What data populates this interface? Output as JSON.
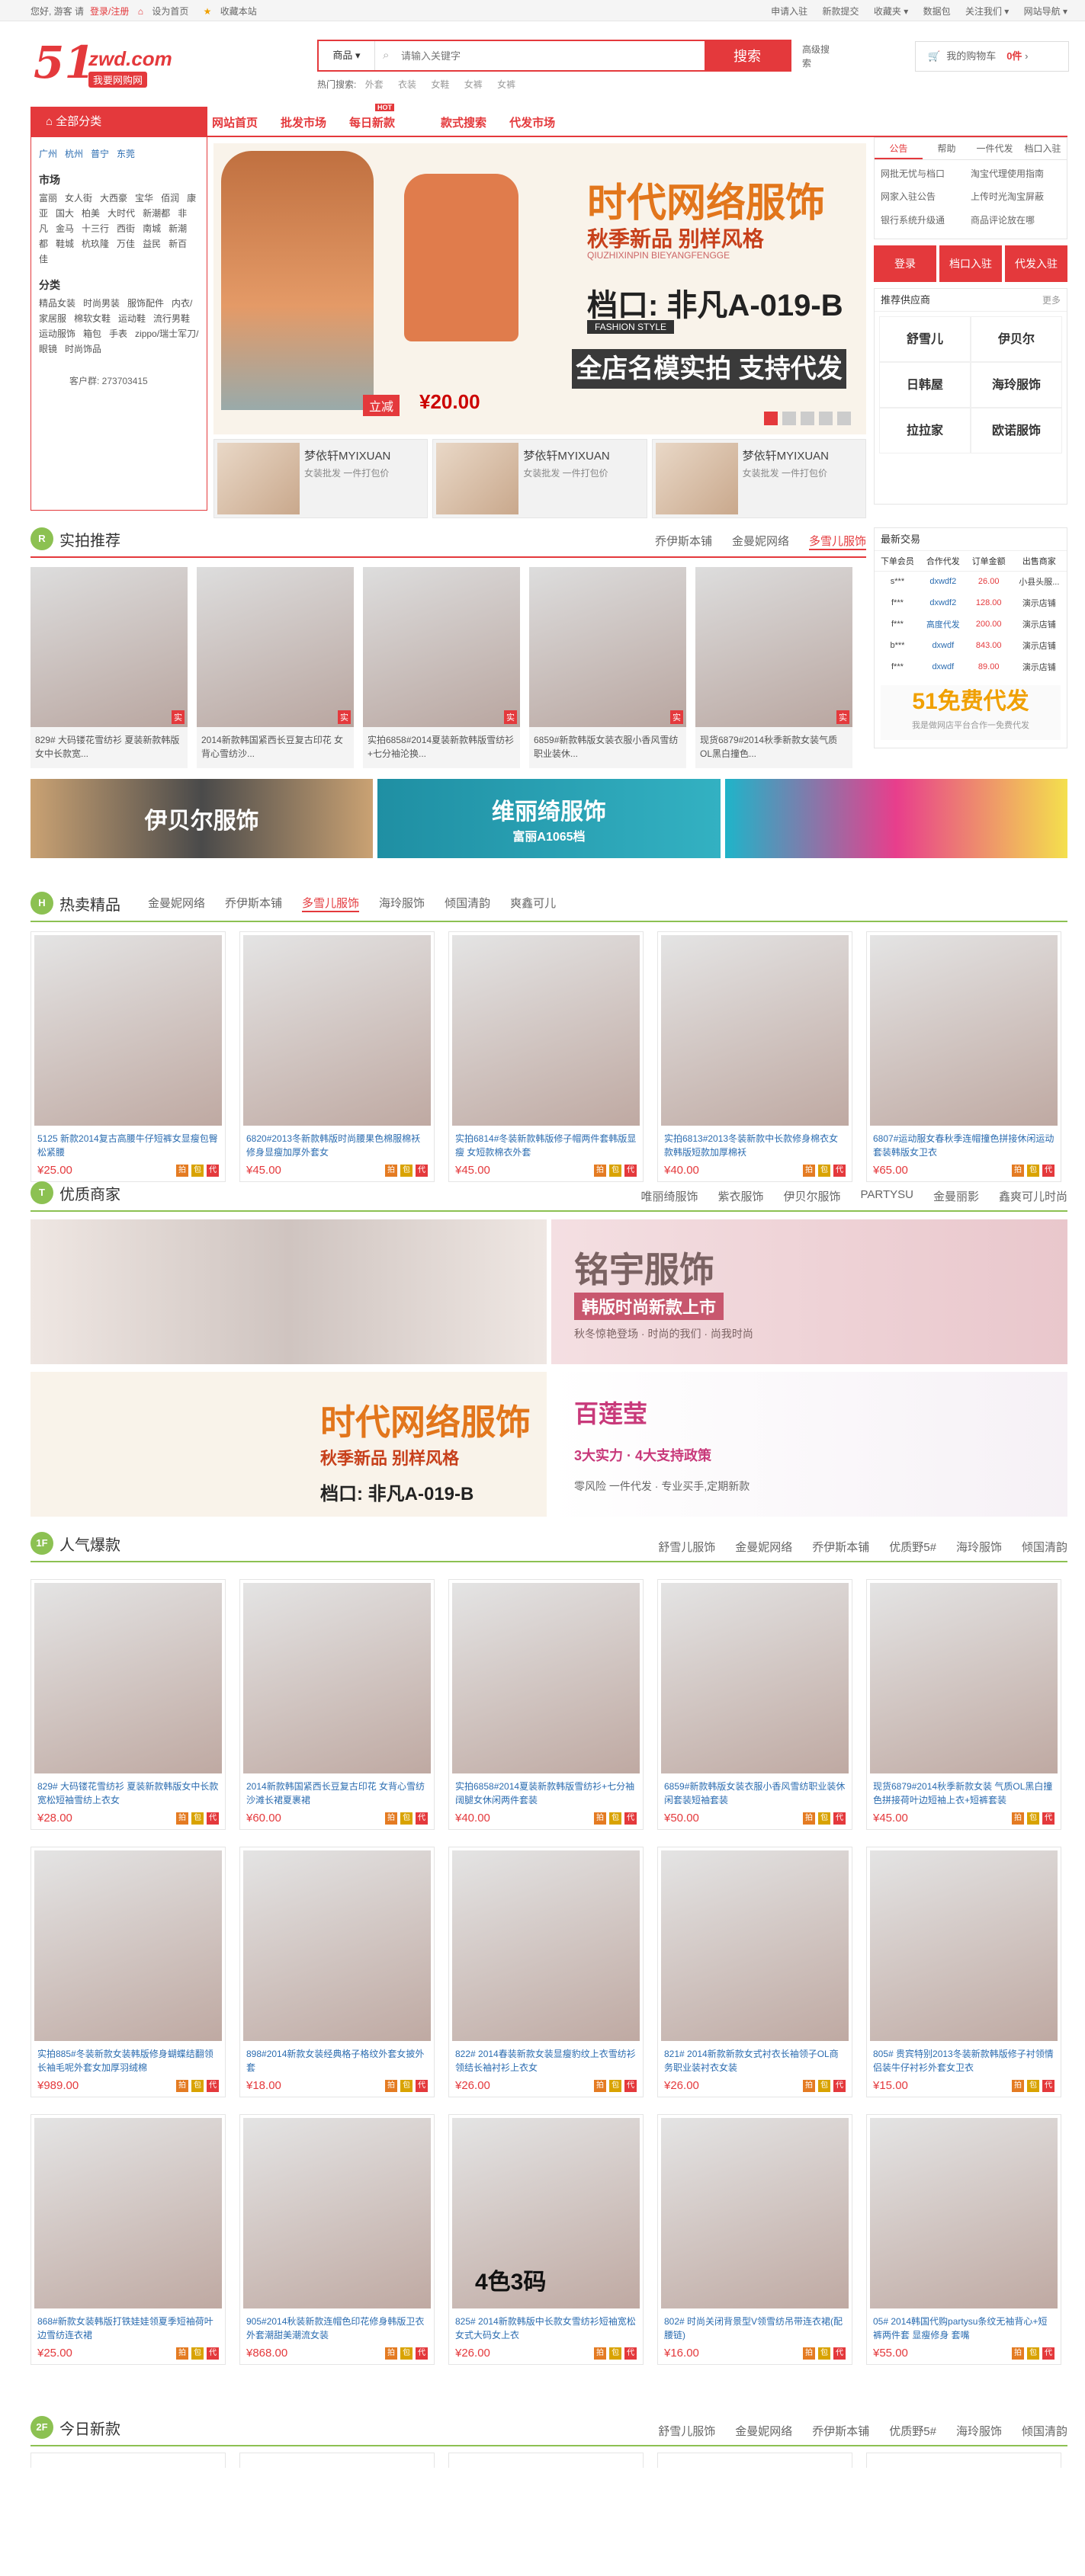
{
  "topbar": {
    "welcome": "您好, 游客 请",
    "login": "登录",
    "register": "/注册",
    "sethome": "设为首页",
    "favorite": "收藏本站",
    "right": [
      "申请入驻",
      "新款提交",
      "收藏夹 ▾",
      "数据包",
      "关注我们 ▾",
      "网站导航 ▾"
    ]
  },
  "logo": {
    "num": "51",
    "domain": "zwd.com",
    "slogan": "我要网购网"
  },
  "search": {
    "category": "商品 ▾",
    "placeholder": "请输入关键字",
    "button": "搜索",
    "advanced": "高级搜索",
    "hot_label": "热门搜索:",
    "hot": [
      "外套",
      "衣装",
      "女鞋",
      "女裤",
      "女裤"
    ]
  },
  "cart": {
    "label": "我的购物车",
    "count": "0件"
  },
  "nav": {
    "allcat": "全部分类",
    "links": [
      "网站首页",
      "批发市场",
      "每日新款",
      "款式搜索",
      "代发市场"
    ],
    "hot": "HOT"
  },
  "catpanel": {
    "cities": [
      "广州",
      "杭州",
      "普宁",
      "东莞"
    ],
    "market_title": "市场",
    "markets": [
      "富丽",
      "女人街",
      "大西豪",
      "宝华",
      "佰润",
      "康亚",
      "国大",
      "柏美",
      "大时代",
      "新潮都",
      "非凡",
      "金马",
      "十三行",
      "西街",
      "南城",
      "新潮都",
      "鞋城",
      "杭玖隆",
      "万佳",
      "益民",
      "新百佳"
    ],
    "type_title": "分类",
    "types": [
      "精品女装",
      "时尚男装",
      "服饰配件",
      "内衣/家居服",
      "棉软女鞋",
      "运动鞋",
      "流行男鞋",
      "运动服饰",
      "箱包",
      "手表",
      "zippo/瑞士军刀/眼镜",
      "时尚饰品"
    ],
    "qq": "客户群: 273703415"
  },
  "mainban": {
    "title": "时代网络服饰",
    "sub": "秋季新品 别样风格",
    "pinyin": "QIUZHIXINPIN BIEYANGFENGGE",
    "stall": "档口: 非凡A-019-B",
    "style": "FASHION STYLE",
    "slogan": "全店名模实拍 支持代发",
    "price": "¥20.00",
    "buy": "立减"
  },
  "subbanners": [
    {
      "t": "梦依轩MYIXUAN",
      "s": "女装批发 一件打包价"
    },
    {
      "t": "梦依轩MYIXUAN",
      "s": "女装批发 一件打包价"
    },
    {
      "t": "梦依轩MYIXUAN",
      "s": "女装批发 一件打包价"
    }
  ],
  "right": {
    "tabs": [
      "公告",
      "帮助",
      "一件代发",
      "档口入驻"
    ],
    "news": [
      "网批无忧与档口",
      "淘宝代理使用指南",
      "网家入驻公告",
      "上传时光淘宝屏蔽",
      "银行系统升级通",
      "商品评论放在哪"
    ],
    "buttons": [
      "登录",
      "档口入驻",
      "代发入驻"
    ],
    "sup_title": "推荐供应商",
    "sup_more": "更多",
    "suppliers": [
      "舒雪儿",
      "伊贝尔",
      "日韩屋",
      "海玲服饰",
      "拉拉家",
      "欧诺服饰"
    ]
  },
  "sec_r": {
    "badge": "R",
    "name": "实拍推荐",
    "tabs": [
      "乔伊斯本铺",
      "金曼妮网络",
      "多雪儿服饰"
    ],
    "items": [
      {
        "desc": "829# 大码镂花雪纺衫 夏装新款韩版女中长款宽...",
        "tag": "实"
      },
      {
        "desc": "2014新款韩国紧西长豆复古印花 女背心雪纺沙...",
        "tag": "实"
      },
      {
        "desc": "实拍6858#2014夏装新款韩版雪纺衫+七分袖沦换...",
        "tag": "实"
      },
      {
        "desc": "6859#新款韩版女装衣服小香风雪纺职业装休...",
        "tag": "实"
      },
      {
        "desc": "现货6879#2014秋季新款女装气质OL黑白撞色...",
        "tag": "实"
      }
    ]
  },
  "trade": {
    "title": "最新交易",
    "headers": [
      "下单会员",
      "合作代发",
      "订单金额",
      "出售商家"
    ],
    "rows": [
      [
        "s***",
        "dxwdf2",
        "26.00",
        "小县头服..."
      ],
      [
        "f***",
        "dxwdf2",
        "128.00",
        "演示店铺"
      ],
      [
        "f***",
        "高度代发",
        "200.00",
        "演示店铺"
      ],
      [
        "b***",
        "dxwdf",
        "843.00",
        "演示店铺"
      ],
      [
        "f***",
        "dxwdf",
        "89.00",
        "演示店铺"
      ]
    ],
    "promo": "51免费代发",
    "promo_sub": "我是做网店平台合作一免费代发"
  },
  "ads1": [
    "伊贝尔服饰",
    "维丽绮服饰",
    "富丽A1065档"
  ],
  "sec_h": {
    "badge": "H",
    "name": "热卖精品",
    "tabs": [
      "金曼妮网络",
      "乔伊斯本铺",
      "多雪儿服饰",
      "海玲服饰",
      "倾国清韵",
      "爽鑫可儿"
    ],
    "items": [
      {
        "desc": "5125 新款2014复古高腰牛仔短裤女显瘦包臀松紧腰",
        "price": "¥25.00"
      },
      {
        "desc": "6820#2013冬新款韩版时尚腰果色棉服棉袄修身显瘦加厚外套女",
        "price": "¥45.00"
      },
      {
        "desc": "实拍6814#冬装新款韩版修子帽两件套韩版显瘦 女短款棉衣外套",
        "price": "¥45.00"
      },
      {
        "desc": "实拍6813#2013冬装新款中长款修身棉衣女款韩版短款加厚棉袄",
        "price": "¥40.00"
      },
      {
        "desc": "6807#运动服女春秋季连帽撞色拼接休闲运动套装韩版女卫衣",
        "price": "¥65.00"
      }
    ]
  },
  "sec_t": {
    "badge": "T",
    "name": "优质商家",
    "tabs": [
      "唯丽绮服饰",
      "紫衣服饰",
      "伊贝尔服饰",
      "PARTYSU",
      "金曼丽影",
      "鑫爽可儿时尚"
    ],
    "banners": [
      {
        "t": "",
        "s": "",
        "s2": ""
      },
      {
        "t": "铭宇服饰",
        "s": "韩版时尚新款上市",
        "s2": "秋冬惊艳登场 · 时尚的我们 · 尚我时尚"
      },
      {
        "t": "时代网络服饰",
        "s": "秋季新品 别样风格",
        "s2": "档口: 非凡A-019-B"
      },
      {
        "t": "百莲莹",
        "s": "3大实力 · 4大支持政策",
        "s2": "零风险 一件代发 · 专业买手,定期新款"
      }
    ]
  },
  "sec_1f": {
    "badge": "1F",
    "name": "人气爆款",
    "tabs": [
      "舒雪儿服饰",
      "金曼妮网络",
      "乔伊斯本铺",
      "优质野5#",
      "海玲服饰",
      "倾国清韵"
    ],
    "items": [
      {
        "desc": "829# 大码镂花雪纺衫 夏装新款韩版女中长款宽松短袖雪纺上衣女",
        "price": "¥28.00"
      },
      {
        "desc": "2014新款韩国紧西长豆复古印花 女背心雪纺沙滩长裙夏裹裙",
        "price": "¥60.00"
      },
      {
        "desc": "实拍6858#2014夏装新款韩版雪纺衫+七分袖阔腿女休闲两件套装",
        "price": "¥40.00"
      },
      {
        "desc": "6859#新款韩版女装衣服小香风雪纺职业装休闲套装短袖套装",
        "price": "¥50.00"
      },
      {
        "desc": "现货6879#2014秋季新款女装 气质OL黑白撞色拼接荷叶边短袖上衣+短裤套装",
        "price": "¥45.00"
      },
      {
        "desc": "实拍885#冬装新款女装韩版修身蝴蝶结翻领长袖毛呢外套女加厚羽绒棉",
        "price": "¥989.00"
      },
      {
        "desc": "898#2014新款女装经典格子格纹外套女披外套",
        "price": "¥18.00"
      },
      {
        "desc": "822# 2014春装新款女装显瘦豹纹上衣雪纺衫领结长袖衬衫上衣女",
        "price": "¥26.00"
      },
      {
        "desc": "821# 2014新款新款女式衬衣长袖领子OL商务职业装衬衣女装",
        "price": "¥26.00"
      },
      {
        "desc": "805# 贵宾特别2013冬装新款韩版修子衬领情侣装牛仔衬衫外套女卫衣",
        "price": "¥15.00"
      },
      {
        "desc": "868#新款女装韩版打铁娃娃领夏季短袖荷叶边雪纺连衣裙",
        "price": "¥25.00"
      },
      {
        "desc": "905#2014秋装新款连帽色印花修身韩版卫衣外套潮甜美潮流女装",
        "price": "¥868.00"
      },
      {
        "desc": "825# 2014新款韩版中长款女雪纺衫短袖宽松女式大码女上衣",
        "price": "¥26.00"
      },
      {
        "desc": "802# 时尚关闭背景型V领雪纺吊带连衣裙(配腰链)",
        "price": "¥16.00"
      },
      {
        "desc": "05# 2014韩国代购partysu条纹无袖背心+短裤两件套 显瘦修身 套嘴",
        "price": "¥55.00"
      }
    ],
    "colors_tag": "4色3码"
  },
  "sec_2f": {
    "badge": "2F",
    "name": "今日新款",
    "tabs": [
      "舒雪儿服饰",
      "金曼妮网络",
      "乔伊斯本铺",
      "优质野5#",
      "海玲服饰",
      "倾国清韵"
    ]
  }
}
